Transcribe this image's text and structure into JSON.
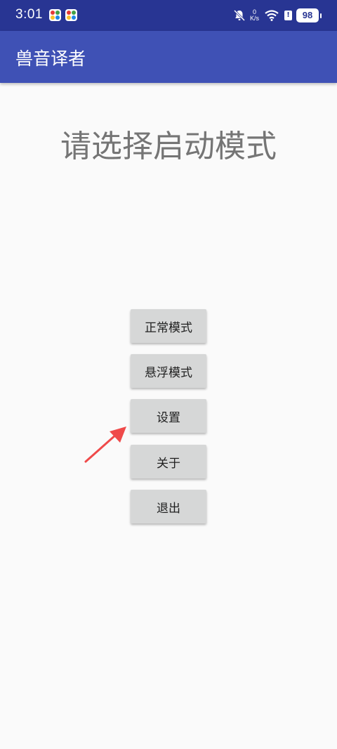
{
  "status_bar": {
    "time": "3:01",
    "net_speed_value": "0",
    "net_speed_unit": "K/s",
    "alert": "!",
    "battery": "98"
  },
  "app_bar": {
    "title": "兽音译者"
  },
  "main": {
    "prompt": "请选择启动模式",
    "buttons": [
      {
        "label": "正常模式"
      },
      {
        "label": "悬浮模式"
      },
      {
        "label": "设置"
      },
      {
        "label": "关于"
      },
      {
        "label": "退出"
      }
    ]
  },
  "colors": {
    "status_bar": "#283593",
    "app_bar": "#3f51b5",
    "button": "#d6d7d7",
    "arrow": "#ef4a4a"
  }
}
